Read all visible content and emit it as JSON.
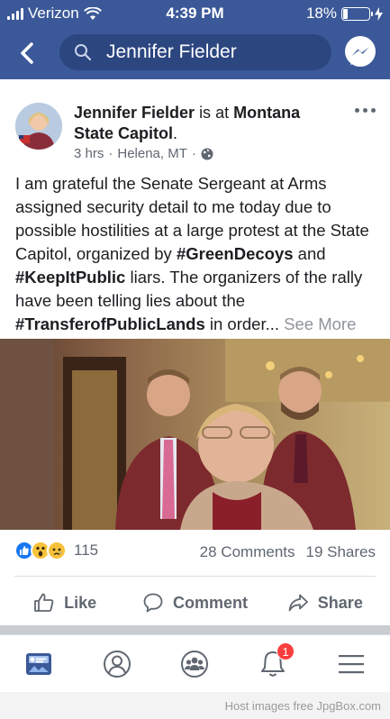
{
  "status_bar": {
    "carrier": "Verizon",
    "time": "4:39 PM",
    "battery": "18%",
    "battery_level": 0.18
  },
  "header": {
    "search_query": "Jennifer Fielder"
  },
  "post": {
    "author_name": "Jennifer Fielder",
    "is_at": "is at",
    "location_tag": "Montana State Capitol",
    "location_suffix": ".",
    "time_ago": "3 hrs",
    "place": "Helena, MT",
    "text": {
      "p1": "I am grateful the Senate Sergeant at Arms assigned security detail to me today due to possible hostilities at a large protest at the State Capitol, organized by ",
      "h1": "#GreenDecoys",
      "p2": " and ",
      "h2": "#KeepItPublic",
      "p3": " liars. The organizers of the rally have been telling lies about the ",
      "h3": "#TransferofPublicLands",
      "p4": " in order... ",
      "see_more": "See More"
    },
    "reaction_count": "115",
    "comments": "28 Comments",
    "shares": "19 Shares",
    "actions": {
      "like": "Like",
      "comment": "Comment",
      "share": "Share"
    }
  },
  "tabbar": {
    "notification_badge": "1"
  },
  "watermark": "Host images free JpgBox.com",
  "colors": {
    "brand_blue": "#3b5998",
    "badge_red": "#fa3e3e",
    "like_blue": "#1877f2",
    "wow_yellow": "#f7c23a"
  }
}
